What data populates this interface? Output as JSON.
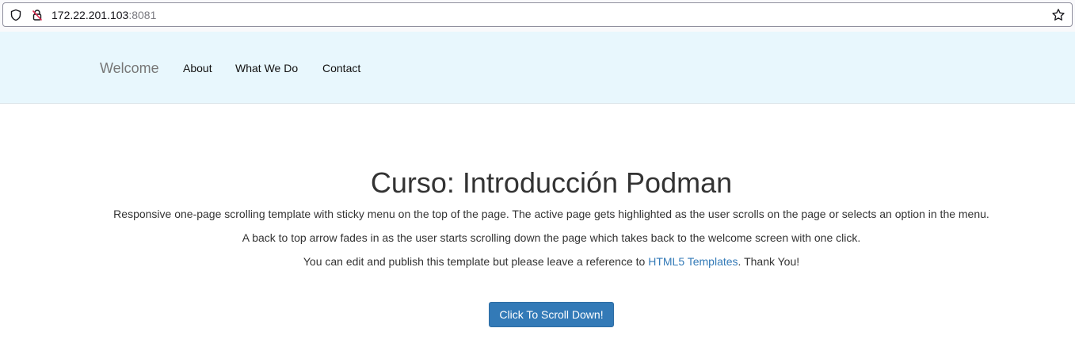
{
  "browser": {
    "url_host": "172.22.201.103",
    "url_port": ":8081",
    "icons": [
      "shield-icon",
      "insecure-lock-icon",
      "bookmark-star-icon"
    ]
  },
  "navbar": {
    "brand": "Welcome",
    "links": [
      "About",
      "What We Do",
      "Contact"
    ],
    "background": "#e8f7fd"
  },
  "intro": {
    "title": "Curso: Introducción Podman",
    "paragraph1": "Responsive one-page scrolling template with sticky menu on the top of the page. The active page gets highlighted as the user scrolls on the page or selects an option in the menu.",
    "paragraph2": "A back to top arrow fades in as the user starts scrolling down the page which takes back to the welcome screen with one click.",
    "paragraph3_before": "You can edit and publish this template but please leave a reference to ",
    "paragraph3_link": "HTML5 Templates",
    "paragraph3_after": ". Thank You!",
    "button_label": "Click To Scroll Down!",
    "link_color": "#337ab7",
    "button_color": "#337ab7"
  }
}
